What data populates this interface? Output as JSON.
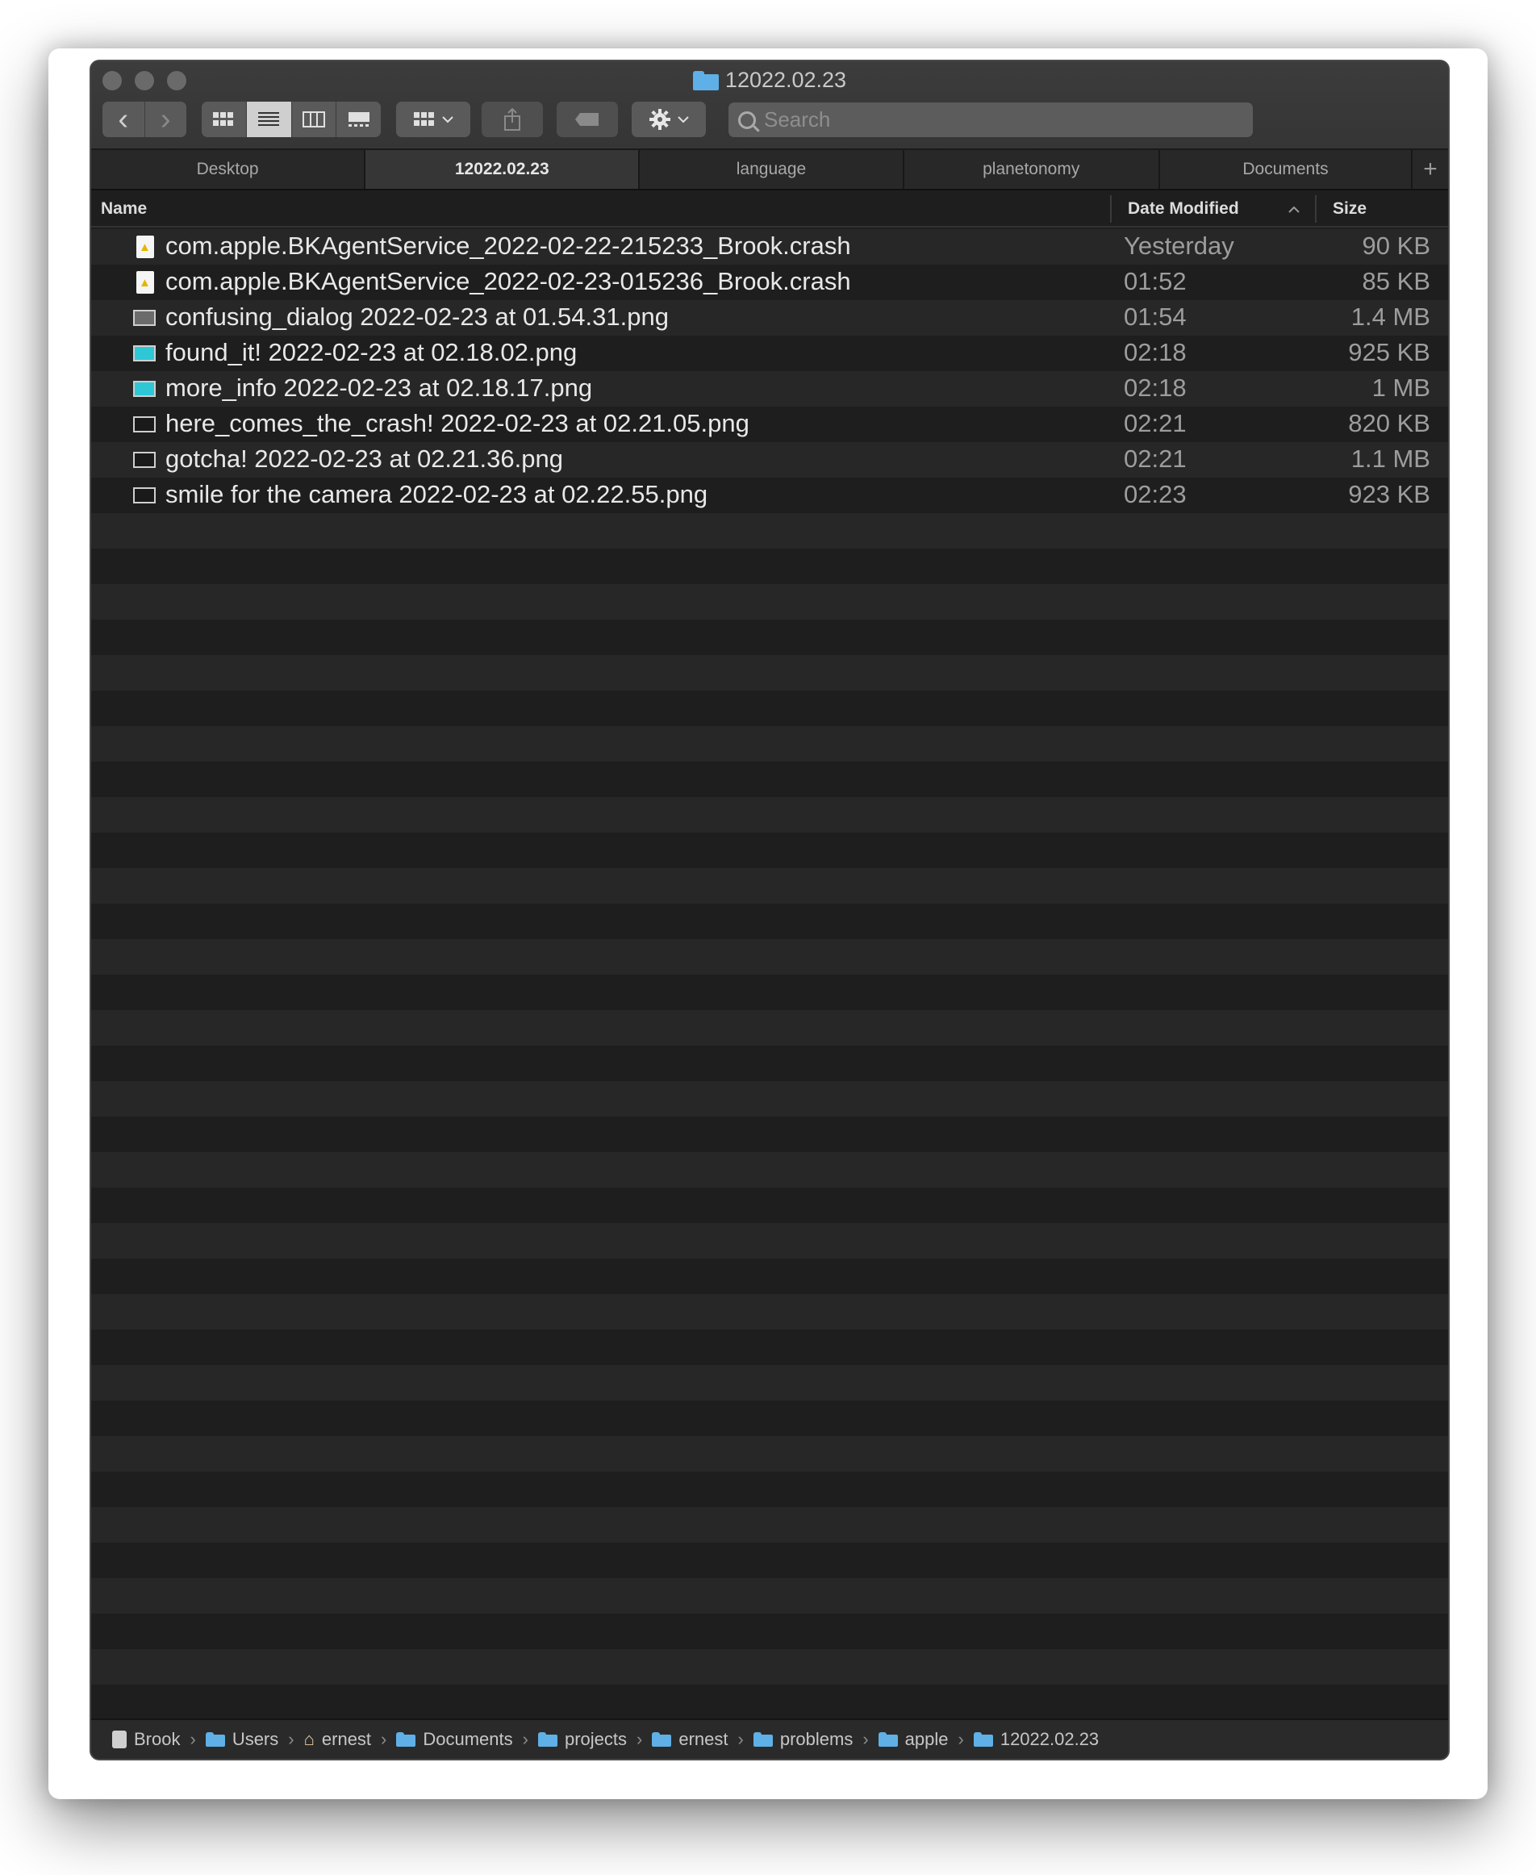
{
  "window": {
    "title": "12022.02.23"
  },
  "toolbar": {
    "back": "‹",
    "forward": "›",
    "search_placeholder": "Search"
  },
  "tabs": [
    {
      "label": "Desktop",
      "active": false
    },
    {
      "label": "12022.02.23",
      "active": true
    },
    {
      "label": "language",
      "active": false
    },
    {
      "label": "planetonomy",
      "active": false
    },
    {
      "label": "Documents",
      "active": false
    }
  ],
  "columns": {
    "name": "Name",
    "date": "Date Modified",
    "size": "Size",
    "sort_indicator": "^"
  },
  "files": [
    {
      "name": "com.apple.BKAgentService_2022-02-22-215233_Brook.crash",
      "date": "Yesterday",
      "size": "90 KB",
      "icon": "crash-log-icon"
    },
    {
      "name": "com.apple.BKAgentService_2022-02-23-015236_Brook.crash",
      "date": "01:52",
      "size": "85 KB",
      "icon": "crash-log-icon"
    },
    {
      "name": "confusing_dialog 2022-02-23 at 01.54.31.png",
      "date": "01:54",
      "size": "1.4 MB",
      "icon": "image-thumbnail-icon"
    },
    {
      "name": "found_it! 2022-02-23 at 02.18.02.png",
      "date": "02:18",
      "size": "925 KB",
      "icon": "image-thumbnail-icon"
    },
    {
      "name": "more_info 2022-02-23 at 02.18.17.png",
      "date": "02:18",
      "size": "1 MB",
      "icon": "image-thumbnail-icon"
    },
    {
      "name": "here_comes_the_crash! 2022-02-23 at 02.21.05.png",
      "date": "02:21",
      "size": "820 KB",
      "icon": "image-thumbnail-icon"
    },
    {
      "name": "gotcha! 2022-02-23 at 02.21.36.png",
      "date": "02:21",
      "size": "1.1 MB",
      "icon": "image-thumbnail-icon"
    },
    {
      "name": "smile for the camera 2022-02-23 at 02.22.55.png",
      "date": "02:23",
      "size": "923 KB",
      "icon": "image-thumbnail-icon"
    }
  ],
  "pathbar": [
    {
      "label": "Brook",
      "icon": "disk-icon"
    },
    {
      "label": "Users",
      "icon": "folder-icon"
    },
    {
      "label": "ernest",
      "icon": "home-icon"
    },
    {
      "label": "Documents",
      "icon": "folder-icon"
    },
    {
      "label": "projects",
      "icon": "folder-icon"
    },
    {
      "label": "ernest",
      "icon": "folder-icon"
    },
    {
      "label": "problems",
      "icon": "folder-icon"
    },
    {
      "label": "apple",
      "icon": "folder-icon"
    },
    {
      "label": "12022.02.23",
      "icon": "folder-icon"
    }
  ],
  "pathbar_separator": "›",
  "colors": {
    "stripe_dark": "#1e1e1e",
    "stripe_light": "#272727",
    "folder_blue": "#5fb0e6"
  }
}
